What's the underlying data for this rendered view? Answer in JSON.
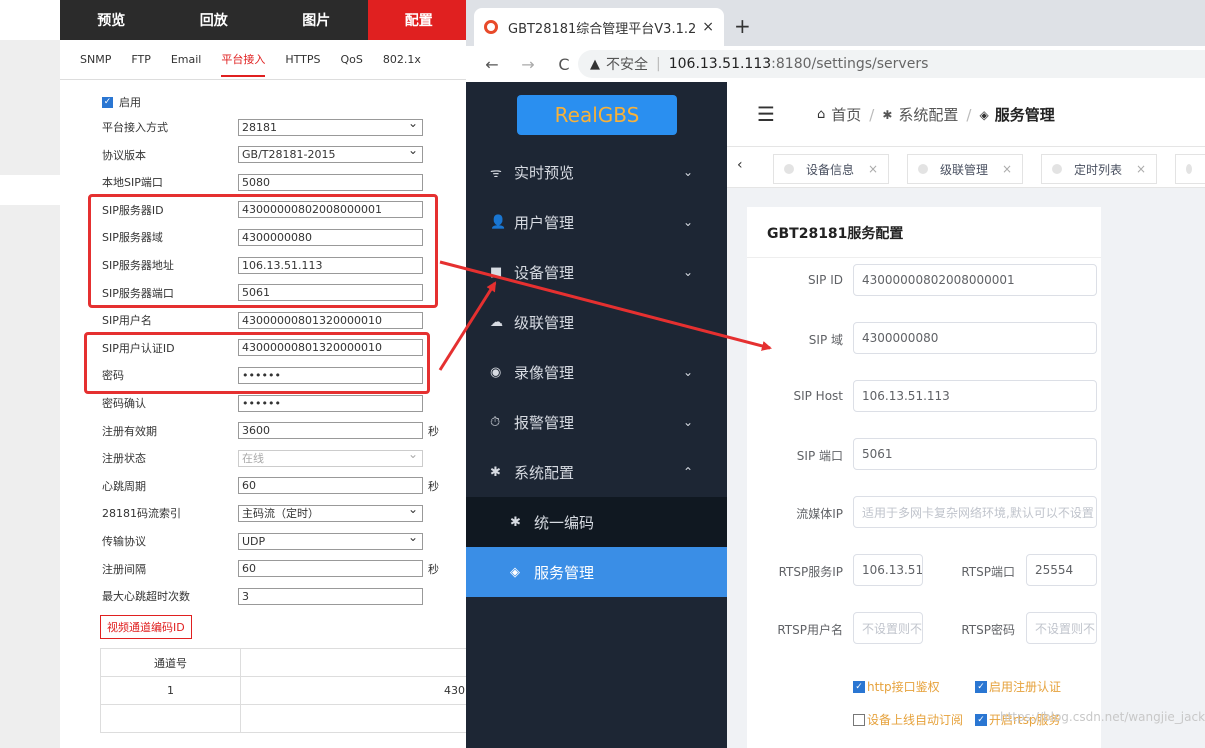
{
  "left": {
    "topnav": [
      "预览",
      "回放",
      "图片",
      "配置"
    ],
    "active_topnav": 3,
    "subtabs": [
      "SNMP",
      "FTP",
      "Email",
      "平台接入",
      "HTTPS",
      "QoS",
      "802.1x"
    ],
    "active_subtab": 3,
    "enable_label": "启用",
    "rows": [
      {
        "label": "平台接入方式",
        "value": "28181",
        "type": "select"
      },
      {
        "label": "协议版本",
        "value": "GB/T28181-2015",
        "type": "select"
      },
      {
        "label": "本地SIP端口",
        "value": "5080",
        "type": "text"
      },
      {
        "label": "SIP服务器ID",
        "value": "43000000802008000001",
        "type": "text"
      },
      {
        "label": "SIP服务器域",
        "value": "4300000080",
        "type": "text"
      },
      {
        "label": "SIP服务器地址",
        "value": "106.13.51.113",
        "type": "text"
      },
      {
        "label": "SIP服务器端口",
        "value": "5061",
        "type": "text"
      },
      {
        "label": "SIP用户名",
        "value": "43000000801320000010",
        "type": "text"
      },
      {
        "label": "SIP用户认证ID",
        "value": "43000000801320000010",
        "type": "text"
      },
      {
        "label": "密码",
        "value": "••••••",
        "type": "password"
      },
      {
        "label": "密码确认",
        "value": "••••••",
        "type": "password"
      },
      {
        "label": "注册有效期",
        "value": "3600",
        "type": "text",
        "unit": "秒"
      },
      {
        "label": "注册状态",
        "value": "在线",
        "type": "select-disabled"
      },
      {
        "label": "心跳周期",
        "value": "60",
        "type": "text",
        "unit": "秒"
      },
      {
        "label": "28181码流索引",
        "value": "主码流（定时）",
        "type": "select"
      },
      {
        "label": "传输协议",
        "value": "UDP",
        "type": "select"
      },
      {
        "label": "注册间隔",
        "value": "60",
        "type": "text",
        "unit": "秒"
      },
      {
        "label": "最大心跳超时次数",
        "value": "3",
        "type": "text"
      }
    ],
    "encode_button": "视频通道编码ID",
    "table": {
      "header": "通道号",
      "row_no": "1",
      "row_val": "430"
    }
  },
  "browser": {
    "tab_title": "GBT28181综合管理平台V3.1.2",
    "tab_close": "×",
    "new_tab": "+",
    "nav": {
      "back": "←",
      "forward": "→",
      "reload": "C"
    },
    "insecure_label": "不安全",
    "url_host": "106.13.51.113",
    "url_path": ":8180/settings/servers"
  },
  "sidebar": {
    "logo": "RealGBS",
    "items": [
      {
        "label": "实时预览",
        "icon": "pulse-icon",
        "glyph": "ᯤ",
        "chevron": "⌄"
      },
      {
        "label": "用户管理",
        "icon": "user-icon",
        "glyph": "👤",
        "chevron": "⌄"
      },
      {
        "label": "设备管理",
        "icon": "camera-icon",
        "glyph": "■",
        "chevron": "⌄"
      },
      {
        "label": "级联管理",
        "icon": "cloud-icon",
        "glyph": "☁",
        "chevron": ""
      },
      {
        "label": "录像管理",
        "icon": "record-icon",
        "glyph": "◉",
        "chevron": "⌄"
      },
      {
        "label": "报警管理",
        "icon": "clock-icon",
        "glyph": "⏱",
        "chevron": "⌄"
      },
      {
        "label": "系统配置",
        "icon": "gear-icon",
        "glyph": "✱",
        "chevron": "⌃"
      }
    ],
    "subitems": [
      {
        "label": "统一编码",
        "icon": "gear-small-icon",
        "glyph": "✱"
      },
      {
        "label": "服务管理",
        "icon": "cube-icon",
        "glyph": "◈"
      }
    ]
  },
  "header": {
    "breadcrumb": [
      "首页",
      "系统配置",
      "服务管理"
    ],
    "sep": "/"
  },
  "tags": [
    {
      "label": "设备信息"
    },
    {
      "label": "级联管理"
    },
    {
      "label": "定时列表"
    }
  ],
  "card": {
    "title": "GBT28181服务配置",
    "fields": [
      {
        "label": "SIP ID",
        "value": "43000000802008000001"
      },
      {
        "label": "SIP 域",
        "value": "4300000080"
      },
      {
        "label": "SIP Host",
        "value": "106.13.51.113"
      },
      {
        "label": "SIP 端口",
        "value": "5061"
      },
      {
        "label": "流媒体IP",
        "placeholder": "适用于多网卡复杂网络环境,默认可以不设置"
      }
    ],
    "rtsp_ip_label": "RTSP服务IP",
    "rtsp_ip_value": "106.13.51",
    "rtsp_port_label": "RTSP端口",
    "rtsp_port_value": "25554",
    "rtsp_user_label": "RTSP用户名",
    "rtsp_user_placeholder": "不设置则不",
    "rtsp_pwd_label": "RTSP密码",
    "rtsp_pwd_placeholder": "不设置则不",
    "checkboxes": [
      {
        "label": "http接口鉴权",
        "checked": true
      },
      {
        "label": "启用注册认证",
        "checked": true
      },
      {
        "label": "设备上线自动订阅",
        "checked": false
      },
      {
        "label": "开启rtsp服务",
        "checked": true
      }
    ]
  },
  "watermark": "https://blog.csdn.net/wangjie_jack",
  "colors": {
    "accent_red": "#e53030",
    "sidebar_bg": "#1d2634",
    "active_blue": "#3a8ee6"
  }
}
